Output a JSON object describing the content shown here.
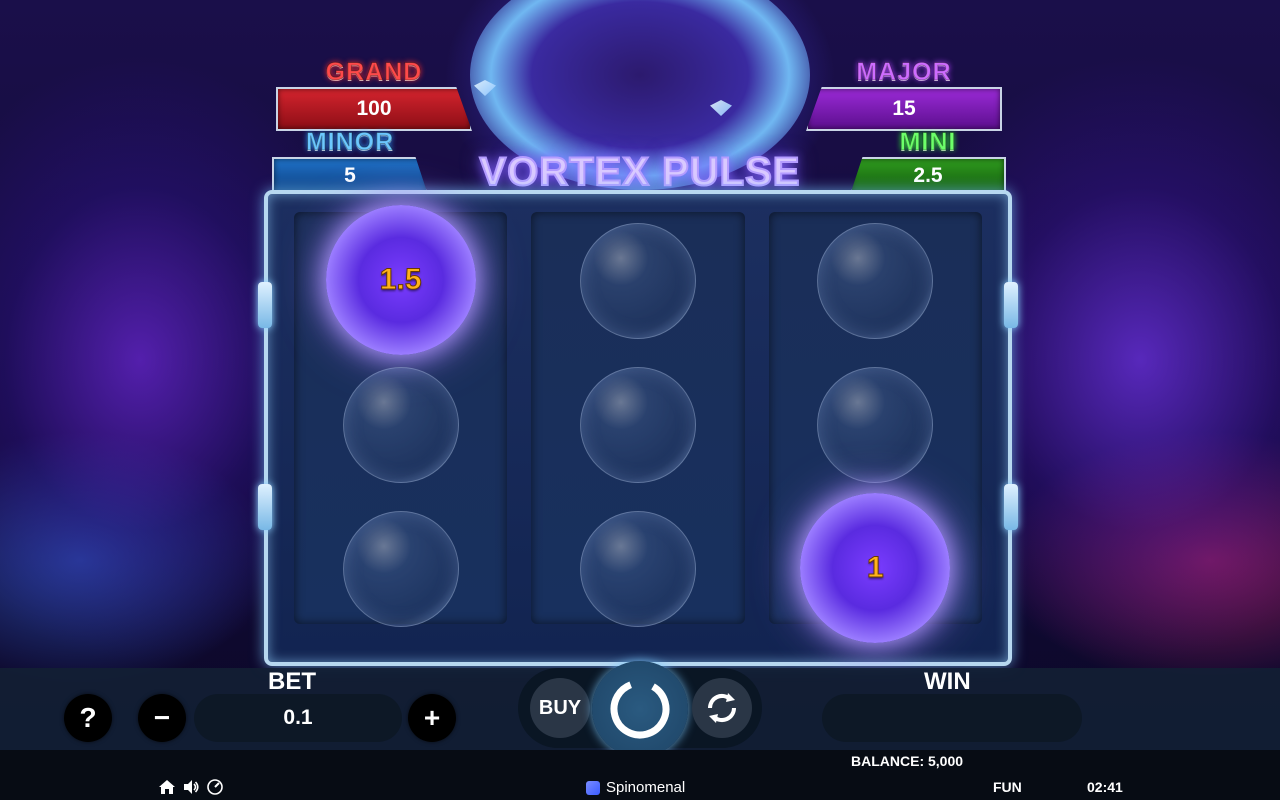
{
  "game": {
    "title": "VORTEX PULSE"
  },
  "jackpots": {
    "grand": {
      "label": "GRAND",
      "value": "100",
      "color": "#d4242e"
    },
    "major": {
      "label": "MAJOR",
      "value": "15",
      "color": "#9a2ad6"
    },
    "minor": {
      "label": "MINOR",
      "value": "5",
      "color": "#1f72c8"
    },
    "mini": {
      "label": "MINI",
      "value": "2.5",
      "color": "#2f9b1f"
    }
  },
  "reels": [
    {
      "symbols": [
        {
          "type": "orb",
          "value": "1.5"
        },
        {
          "type": "bubble"
        },
        {
          "type": "bubble"
        }
      ]
    },
    {
      "symbols": [
        {
          "type": "bubble"
        },
        {
          "type": "bubble"
        },
        {
          "type": "bubble"
        }
      ]
    },
    {
      "symbols": [
        {
          "type": "bubble"
        },
        {
          "type": "bubble"
        },
        {
          "type": "orb",
          "value": "1"
        }
      ]
    }
  ],
  "controls": {
    "help_icon": "?",
    "bet_label": "BET",
    "bet_value": "0.1",
    "minus_icon": "−",
    "plus_icon": "+",
    "buy_label": "BUY",
    "win_label": "WIN",
    "win_value": ""
  },
  "status": {
    "balance_text": "BALANCE: 5,000",
    "mode": "FUN",
    "clock": "02:41",
    "provider": "Spinomenal"
  },
  "icons": [
    "home-icon",
    "sound-icon",
    "speed-icon",
    "spin-icon",
    "autoplay-icon",
    "question-icon"
  ]
}
